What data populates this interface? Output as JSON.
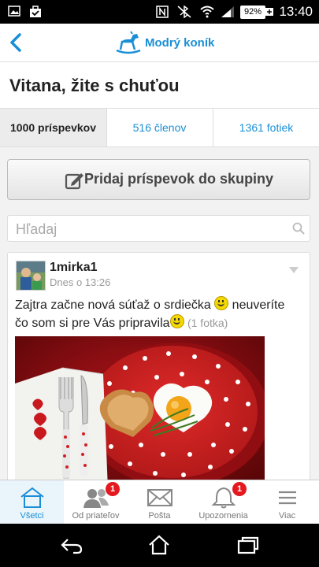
{
  "status_bar": {
    "battery": "92%",
    "clock": "13:40"
  },
  "app_bar": {
    "brand_name": "Modrý koník"
  },
  "group": {
    "title": "Vitana, žite s chuťou"
  },
  "tabs": [
    {
      "label": "1000 príspevkov"
    },
    {
      "label": "516 členov"
    },
    {
      "label": "1361 fotiek"
    }
  ],
  "add_post": {
    "label": "Pridaj príspevok do skupiny"
  },
  "search": {
    "placeholder": "Hľadaj",
    "value": ""
  },
  "post": {
    "author": "1mirka1",
    "time": "Dnes o 13:26",
    "text_part1": "Zajtra začne nová súťaž o srdiečka ",
    "text_part2": " neuveríte čo som si pre Vás pripravila",
    "photo_count": "(1 fotka)"
  },
  "bottom_nav": [
    {
      "label": "Všetci",
      "icon": "home-icon",
      "badge": ""
    },
    {
      "label": "Od priateľov",
      "icon": "friends-icon",
      "badge": "1"
    },
    {
      "label": "Pošta",
      "icon": "mail-icon",
      "badge": ""
    },
    {
      "label": "Upozornenia",
      "icon": "bell-icon",
      "badge": "1"
    },
    {
      "label": "Viac",
      "icon": "menu-icon",
      "badge": ""
    }
  ],
  "colors": {
    "accent": "#1a8fd6",
    "badge": "#e4181f"
  }
}
